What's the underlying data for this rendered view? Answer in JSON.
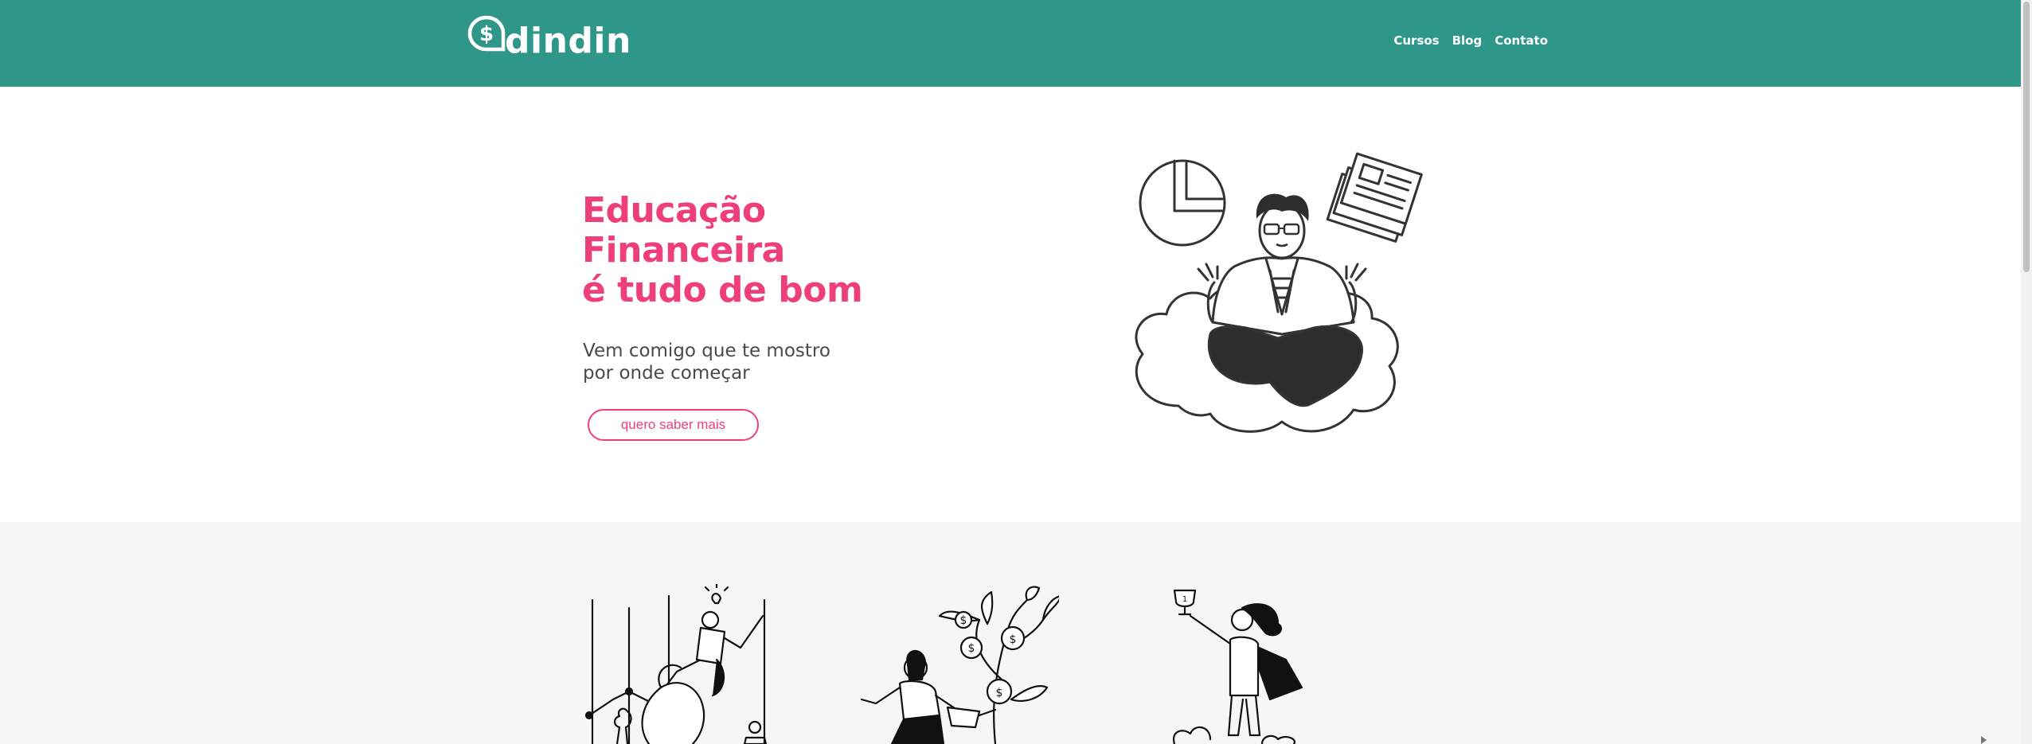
{
  "header": {
    "brand": "dindin",
    "logo_icon": "dollar-bubble-icon",
    "nav": [
      {
        "label": "Cursos"
      },
      {
        "label": "Blog"
      },
      {
        "label": "Contato"
      }
    ],
    "background": "#2f968a"
  },
  "hero": {
    "title_lines": [
      "Educação",
      "Financeira",
      "é tudo de bom"
    ],
    "subtitle_lines": [
      "Vem comigo que te mostro",
      "por onde começar"
    ],
    "cta_label": "quero saber mais",
    "accent": "#ee3e7c",
    "illustration": "meditating-person-on-cloud-illustration"
  },
  "features": {
    "background": "#f6f6f6",
    "illustrations": [
      "chess-knight-rider-illustration",
      "money-tree-watering-illustration",
      "trophy-hero-illustration"
    ]
  }
}
